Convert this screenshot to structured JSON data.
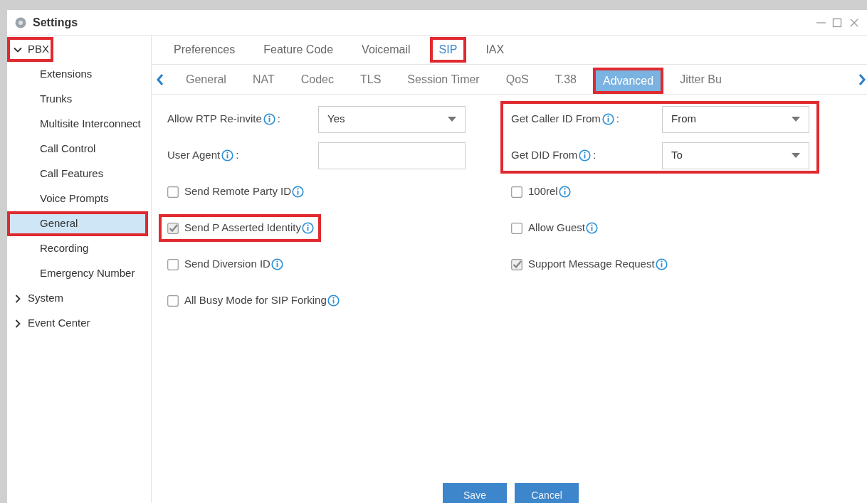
{
  "window": {
    "title": "Settings"
  },
  "sidebar": {
    "items": [
      {
        "label": "PBX",
        "expanded": true,
        "highlighted": true,
        "children": [
          {
            "label": "Extensions",
            "selected": false,
            "highlighted": false
          },
          {
            "label": "Trunks",
            "selected": false,
            "highlighted": false
          },
          {
            "label": "Multisite Interconnect",
            "selected": false,
            "highlighted": false
          },
          {
            "label": "Call Control",
            "selected": false,
            "highlighted": false
          },
          {
            "label": "Call Features",
            "selected": false,
            "highlighted": false
          },
          {
            "label": "Voice Prompts",
            "selected": false,
            "highlighted": false
          },
          {
            "label": "General",
            "selected": true,
            "highlighted": true
          },
          {
            "label": "Recording",
            "selected": false,
            "highlighted": false
          },
          {
            "label": "Emergency Number",
            "selected": false,
            "highlighted": false
          }
        ]
      },
      {
        "label": "System",
        "expanded": false,
        "highlighted": false
      },
      {
        "label": "Event Center",
        "expanded": false,
        "highlighted": false
      }
    ]
  },
  "tabs": [
    {
      "label": "Preferences",
      "selected": false,
      "highlighted": false
    },
    {
      "label": "Feature Code",
      "selected": false,
      "highlighted": false
    },
    {
      "label": "Voicemail",
      "selected": false,
      "highlighted": false
    },
    {
      "label": "SIP",
      "selected": true,
      "highlighted": true
    },
    {
      "label": "IAX",
      "selected": false,
      "highlighted": false
    }
  ],
  "subtabs": [
    {
      "label": "General",
      "selected": false,
      "highlighted": false
    },
    {
      "label": "NAT",
      "selected": false,
      "highlighted": false
    },
    {
      "label": "Codec",
      "selected": false,
      "highlighted": false
    },
    {
      "label": "TLS",
      "selected": false,
      "highlighted": false
    },
    {
      "label": "Session Timer",
      "selected": false,
      "highlighted": false
    },
    {
      "label": "QoS",
      "selected": false,
      "highlighted": false
    },
    {
      "label": "T.38",
      "selected": false,
      "highlighted": false
    },
    {
      "label": "Advanced",
      "selected": true,
      "highlighted": true
    },
    {
      "label": "Jitter Bu",
      "selected": false,
      "highlighted": false
    }
  ],
  "form": {
    "left": [
      {
        "kind": "select",
        "label": "Allow RTP Re-invite",
        "suffix": ":",
        "value": "Yes"
      },
      {
        "kind": "text",
        "label": "User Agent",
        "suffix": ":"
      },
      {
        "kind": "check",
        "label": "Send Remote Party ID",
        "checked": false,
        "highlighted": false
      },
      {
        "kind": "check",
        "label": "Send P Asserted Identity",
        "checked": true,
        "highlighted": true
      },
      {
        "kind": "check",
        "label": "Send Diversion ID",
        "checked": false,
        "highlighted": false
      },
      {
        "kind": "check",
        "label": "All Busy Mode for SIP Forking",
        "checked": false,
        "highlighted": false
      }
    ],
    "right_group": {
      "highlighted": true,
      "items": [
        {
          "kind": "select",
          "label": "Get Caller ID From",
          "suffix": ":",
          "value": "From"
        },
        {
          "kind": "select",
          "label": "Get DID From",
          "suffix": ":",
          "value": "To"
        }
      ]
    },
    "right": [
      {
        "kind": "check",
        "label": "100rel",
        "checked": false,
        "highlighted": false
      },
      {
        "kind": "check",
        "label": "Allow Guest",
        "checked": false,
        "highlighted": false
      },
      {
        "kind": "check",
        "label": "Support Message Request",
        "checked": true,
        "highlighted": false
      }
    ]
  },
  "buttons": [
    {
      "label": "Save"
    },
    {
      "label": "Cancel"
    }
  ]
}
